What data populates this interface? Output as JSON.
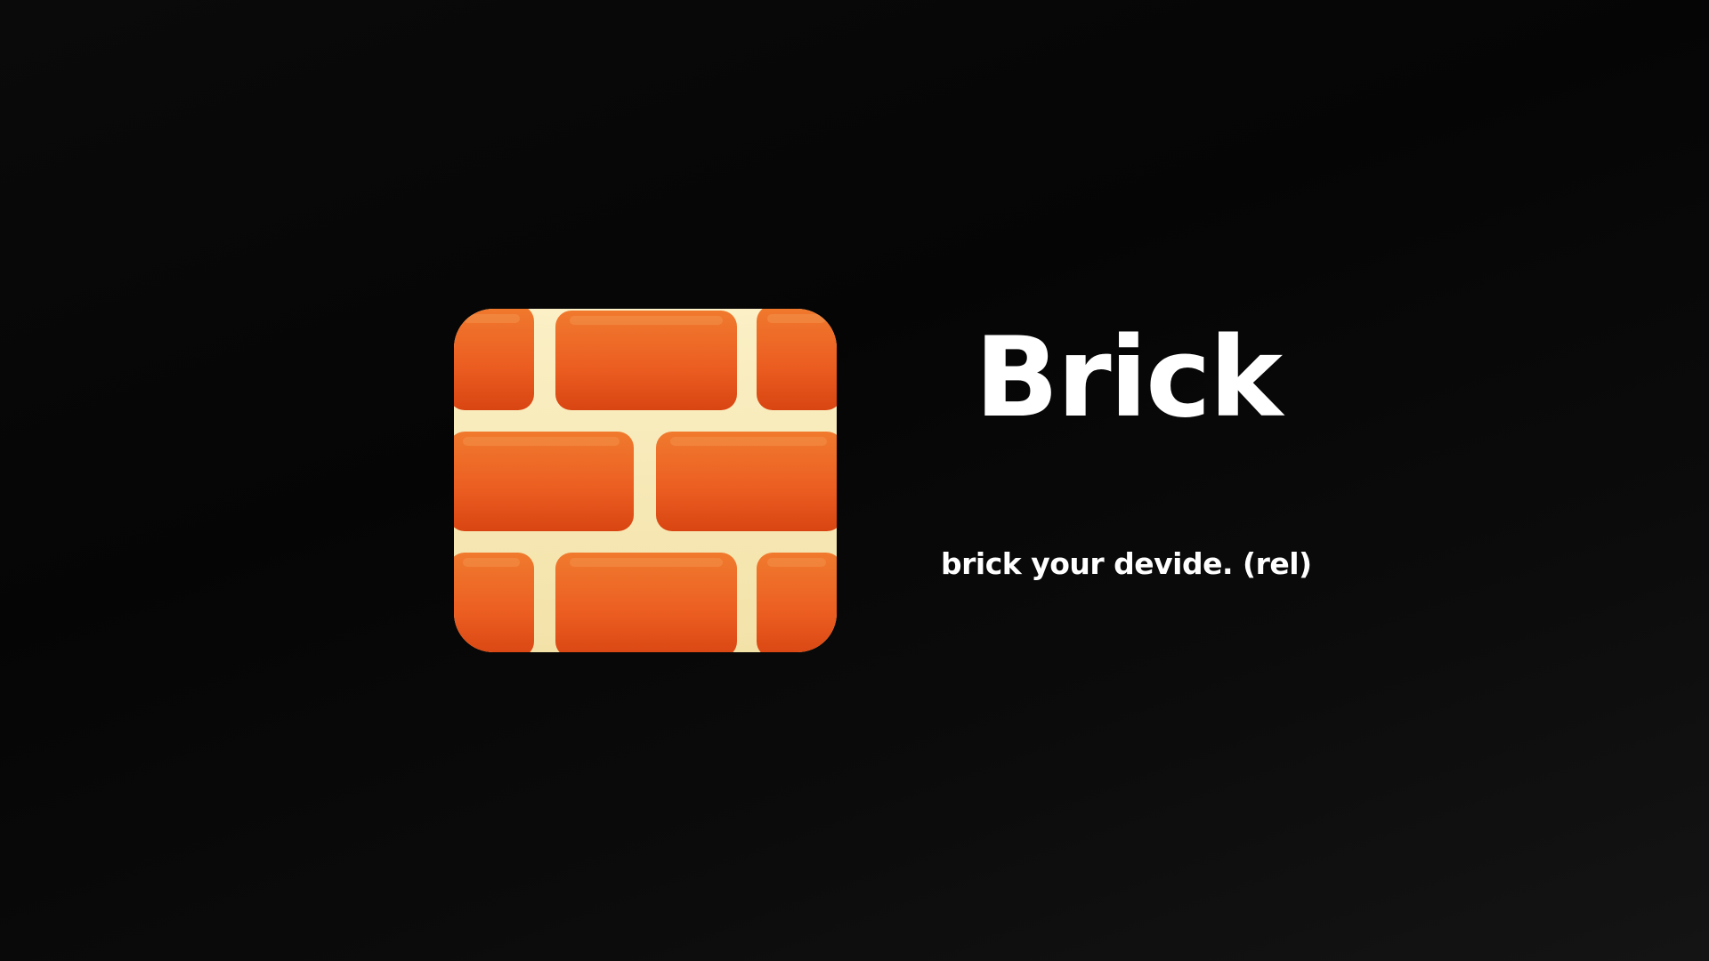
{
  "app": {
    "name": "Brick",
    "tagline": "brick your devide. (rel)",
    "icon": "brick-wall-icon"
  },
  "colors": {
    "background": "#0a0a0a",
    "text": "#ffffff",
    "brick": "#ec5a1f",
    "brick_highlight": "#f07a2e",
    "mortar": "#f7e9b8"
  }
}
